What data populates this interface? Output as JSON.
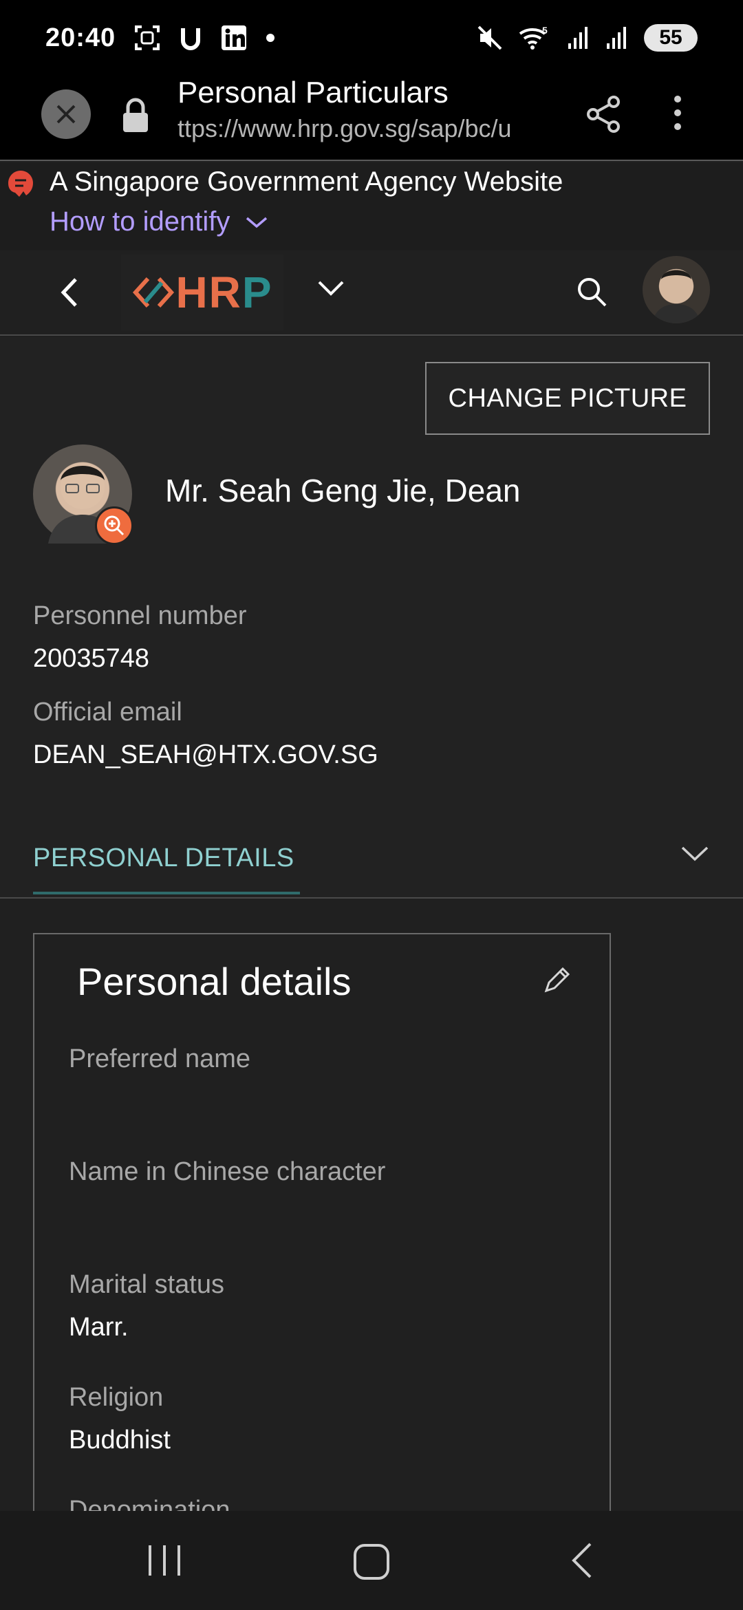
{
  "status_bar": {
    "time": "20:40",
    "battery": "55",
    "icons": [
      "screenshot-icon",
      "u-app-icon",
      "linkedin-icon",
      "dot-icon",
      "mute-icon",
      "wifi-5g-icon",
      "signal-icon",
      "signal-icon"
    ]
  },
  "browser": {
    "title": "Personal Particulars",
    "url": "ttps://www.hrp.gov.sg/sap/bc/u"
  },
  "gov_banner": {
    "text": "A Singapore Government Agency Website",
    "link": "How to identify"
  },
  "app_header": {
    "logo_h": "H",
    "logo_r": "R",
    "logo_p": "P"
  },
  "profile": {
    "change_picture": "CHANGE PICTURE",
    "name": "Mr. Seah Geng Jie, Dean",
    "personnel_label": "Personnel number",
    "personnel_value": "20035748",
    "email_label": "Official email",
    "email_value": "DEAN_SEAH@HTX.GOV.SG"
  },
  "section": {
    "title": "PERSONAL DETAILS"
  },
  "card": {
    "title": "Personal details",
    "fields": [
      {
        "label": "Preferred name",
        "value": ""
      },
      {
        "label": "Name in Chinese character",
        "value": ""
      },
      {
        "label": "Marital status",
        "value": "Marr."
      },
      {
        "label": "Religion",
        "value": "Buddhist"
      },
      {
        "label": "Denomination",
        "value": ""
      }
    ]
  },
  "colors": {
    "accent_link": "#b39dff",
    "section_title": "#8fd0d0",
    "badge": "#ef6c3e",
    "logo_orange": "#e8704a",
    "logo_teal": "#2a8c8c"
  }
}
